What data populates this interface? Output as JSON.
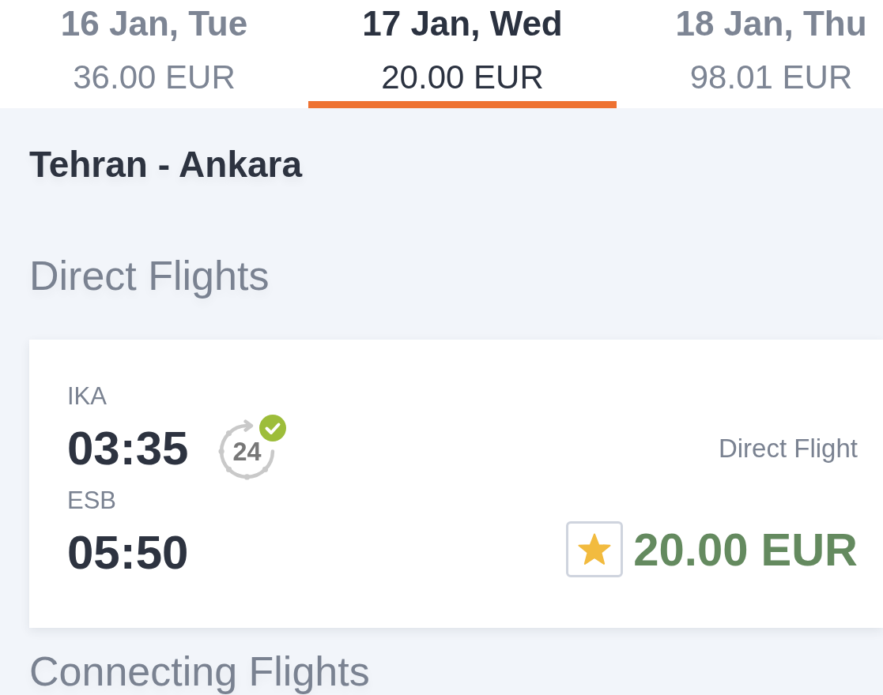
{
  "date_tabs": [
    {
      "date": "16 Jan, Tue",
      "price": "36.00 EUR",
      "selected": false
    },
    {
      "date": "17 Jan, Wed",
      "price": "20.00 EUR",
      "selected": true
    },
    {
      "date": "18 Jan, Thu",
      "price": "98.01 EUR",
      "selected": false
    }
  ],
  "route": {
    "title": "Tehran - Ankara"
  },
  "sections": [
    {
      "title": "Direct Flights",
      "flights": [
        {
          "departure": {
            "airport": "IKA",
            "time": "03:35"
          },
          "arrival": {
            "airport": "ESB",
            "time": "05:50"
          },
          "guarantee_24h": {
            "label": "24",
            "verified": true
          },
          "stop_label": "Direct Flight",
          "starred": true,
          "price": "20.00 EUR"
        }
      ]
    },
    {
      "title": "Connecting Flights"
    }
  ]
}
